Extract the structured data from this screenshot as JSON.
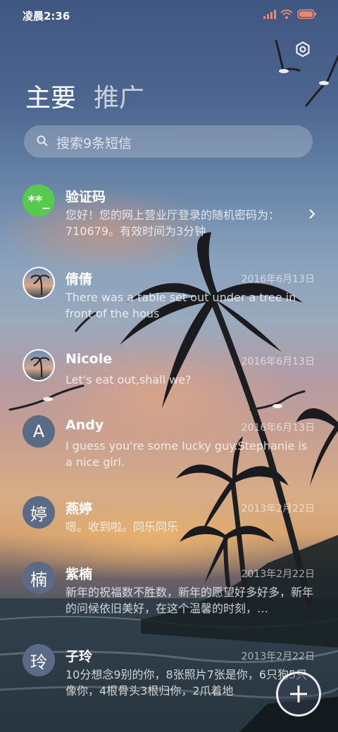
{
  "status_bar": {
    "time": "凌晨2:36",
    "icons": [
      "signal-icon",
      "wifi-icon",
      "battery-icon"
    ]
  },
  "header": {
    "tabs": [
      {
        "label": "主要",
        "active": true
      },
      {
        "label": "推广",
        "active": false
      }
    ]
  },
  "search": {
    "placeholder": "搜索9条短信"
  },
  "conversations": [
    {
      "avatar_text": "**_",
      "avatar_color": "#57c94f",
      "name": "验证码",
      "date": "",
      "preview": "您好！您的网上营业厅登录的随机密码为：710679。有效时间为3分钟"
    },
    {
      "avatar_text": "",
      "avatar_type": "photo",
      "name": "倩倩",
      "date": "2016年6月13日",
      "preview": "There was a table set out under a tree in front of the hous"
    },
    {
      "avatar_text": "",
      "avatar_type": "photo",
      "name": "Nicole",
      "date": "2016年6月13日",
      "preview": "Let's eat out,shall we?"
    },
    {
      "avatar_text": "A",
      "avatar_type": "letter",
      "name": "Andy",
      "date": "2016年6月13日",
      "preview": "I guess you're some lucky guy.Stephanie is a nice girl."
    },
    {
      "avatar_text": "婷",
      "avatar_type": "letter",
      "name": "燕婷",
      "date": "2013年2月22日",
      "preview": "嗯。收到啦。同乐同乐"
    },
    {
      "avatar_text": "楠",
      "avatar_type": "letter",
      "name": "紫楠",
      "date": "2013年2月22日",
      "preview": "新年的祝福数不胜数，新年的愿望好多好多，新年的问候依旧美好，在这个温馨的时刻，…"
    },
    {
      "avatar_text": "玲",
      "avatar_type": "letter",
      "name": "子玲",
      "date": "2013年2月22日",
      "preview": "10分想念9别的你，8张照片7张是你，6只狗5只像你，4根骨头3根归你，2爪着地"
    }
  ],
  "colors": {
    "accent_green": "#57c94f",
    "letter_avatar": "#5b6b86"
  }
}
